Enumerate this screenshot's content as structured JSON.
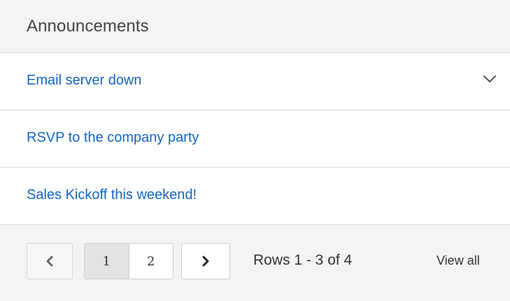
{
  "header": {
    "title": "Announcements"
  },
  "announcements": [
    {
      "title": "Email server down",
      "expandable": true
    },
    {
      "title": "RSVP to the company party",
      "expandable": false
    },
    {
      "title": "Sales Kickoff this weekend!",
      "expandable": false
    }
  ],
  "pagination": {
    "pages": [
      "1",
      "2"
    ],
    "current_page": "1",
    "rows_info": "Rows 1 - 3 of 4",
    "view_all_label": "View all",
    "prev_icon": "chevron-left-icon",
    "next_icon": "chevron-right-icon"
  },
  "colors": {
    "link": "#1565c0",
    "background": "#f4f4f4",
    "divider": "#dcdcdc"
  }
}
